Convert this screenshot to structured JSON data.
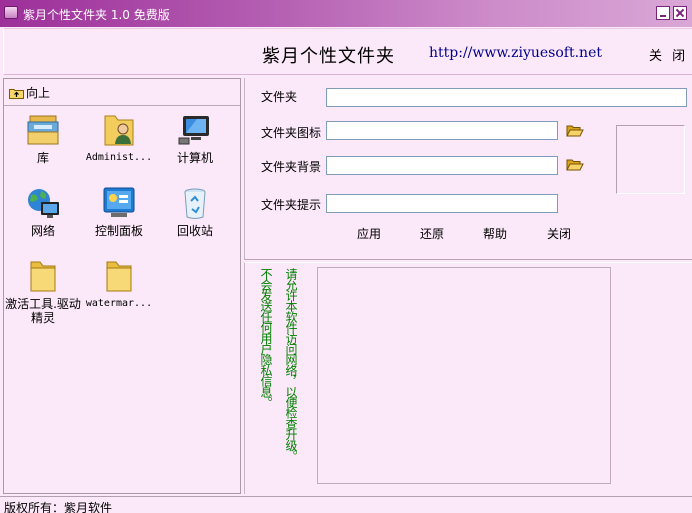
{
  "window": {
    "title": "紫月个性文件夹 1.0 免费版"
  },
  "header": {
    "title": "紫月个性文件夹",
    "url": "http://www.ziyuesoft.net",
    "close_label": "关 闭"
  },
  "left": {
    "up_label": "向上",
    "items": [
      {
        "label": "库",
        "icon": "library-icon"
      },
      {
        "label": "Administ...",
        "icon": "user-folder-icon"
      },
      {
        "label": "计算机",
        "icon": "computer-icon"
      },
      {
        "label": "网络",
        "icon": "network-icon"
      },
      {
        "label": "控制面板",
        "icon": "control-panel-icon"
      },
      {
        "label": "回收站",
        "icon": "recycle-bin-icon"
      },
      {
        "label": "激活工具.驱动精灵",
        "icon": "folder-icon"
      },
      {
        "label": "watermar...",
        "icon": "folder-icon"
      }
    ]
  },
  "form": {
    "folder_label": "文件夹",
    "folder_value": "",
    "icon_label": "文件夹图标",
    "icon_value": "",
    "background_label": "文件夹背景",
    "background_value": "",
    "tip_label": "文件夹提示",
    "tip_value": ""
  },
  "actions": {
    "apply": "应用",
    "restore": "还原",
    "help": "帮助",
    "close": "关闭"
  },
  "notice": {
    "col1": "不会发送任何用户隐私信息。",
    "col2": "请允许本软件访问网络，以便检查升级。"
  },
  "status": {
    "copyright": "版权所有：紫月软件"
  },
  "colors": {
    "background": "#fbe8f8",
    "titlebar": "#9d2f9a",
    "notice_text": "#008000",
    "url": "#00008b"
  }
}
